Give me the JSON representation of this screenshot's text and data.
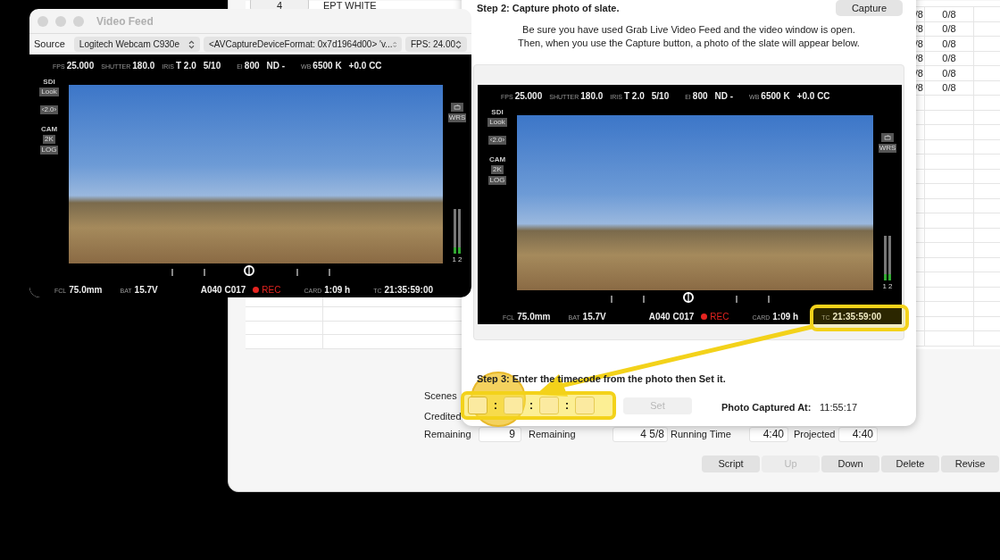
{
  "main_window": {
    "left_table": {
      "rows": [
        [
          "4",
          "EPT WHITE"
        ]
      ]
    },
    "right_table": {
      "rows": [
        [
          "/8",
          "0/8"
        ],
        [
          "/8",
          "0/8"
        ],
        [
          "/8",
          "0/8"
        ],
        [
          "/8",
          "0/8"
        ],
        [
          "/8",
          "0/8"
        ],
        [
          "/8",
          "0/8"
        ]
      ]
    },
    "summary": {
      "scenes_label": "Scenes",
      "credited_label": "Credited",
      "remaining_label": "Remaining",
      "remaining_value": "9",
      "remaining2_label": "Remaining",
      "remaining2_value": "4 5/8",
      "running_time_label": "Running Time",
      "running_time_value": "4:40",
      "projected_label": "Projected",
      "projected_value": "4:40"
    },
    "buttons": [
      {
        "label": "Script",
        "disabled": false
      },
      {
        "label": "Up",
        "disabled": true
      },
      {
        "label": "Down",
        "disabled": false
      },
      {
        "label": "Delete",
        "disabled": false
      },
      {
        "label": "Revise",
        "disabled": false
      }
    ]
  },
  "capture_dialog": {
    "step2_title": "Step 2: Capture photo of slate.",
    "capture_button": "Capture",
    "instructions": [
      "Be sure you have used Grab Live Video Feed and the video window is open.",
      "Then, when you use the Capture button, a photo of the slate will appear below."
    ],
    "viewfinder": {
      "top": [
        {
          "label": "FPS",
          "value": "25.000"
        },
        {
          "label": "SHUTTER",
          "value": "180.0"
        },
        {
          "label": "IRIS",
          "value": "T 2.0"
        },
        {
          "value": "5/10"
        },
        {
          "label": "EI",
          "value": "800"
        },
        {
          "value": "ND -"
        },
        {
          "label": "WB",
          "value": "6500 K"
        },
        {
          "value": "+0.0 CC"
        }
      ],
      "left": [
        {
          "kind": "heading",
          "text": "SDI"
        },
        {
          "kind": "chip",
          "text": "Look"
        },
        {
          "kind": "chip",
          "text": "‹2.0›"
        },
        {
          "kind": "heading",
          "text": "CAM"
        },
        {
          "kind": "chip",
          "text": "2K"
        },
        {
          "kind": "chip",
          "text": "LOG"
        }
      ],
      "right_chip": "WRS",
      "meter_labels": "1 2",
      "bottom": [
        {
          "label": "FCL",
          "value": "75.0mm"
        },
        {
          "label": "BAT",
          "value": "15.7V"
        },
        {
          "value": "A040 C017"
        },
        {
          "kind": "rec",
          "value": "REC"
        },
        {
          "label": "CARD",
          "value": "1:09 h"
        },
        {
          "label": "TC",
          "value": "21:35:59:00"
        }
      ]
    },
    "step3_title": "Step 3: Enter the timecode from the photo then Set it.",
    "timecode_separators": [
      ":",
      ":",
      ":"
    ],
    "set_button": {
      "label": "Set",
      "disabled": true
    },
    "captured_label": "Photo Captured At:",
    "captured_value": "11:55:17"
  },
  "video_feed": {
    "title": "Video Feed",
    "source_label": "Source",
    "selects": [
      "Logitech Webcam C930e",
      "<AVCaptureDeviceFormat: 0x7d1964d00> 'v...",
      "FPS: 24.00"
    ],
    "viewfinder": {
      "top": [
        {
          "label": "FPS",
          "value": "25.000"
        },
        {
          "label": "SHUTTER",
          "value": "180.0"
        },
        {
          "label": "IRIS",
          "value": "T 2.0"
        },
        {
          "value": "5/10"
        },
        {
          "label": "EI",
          "value": "800"
        },
        {
          "value": "ND -"
        },
        {
          "label": "WB",
          "value": "6500 K"
        },
        {
          "value": "+0.0 CC"
        }
      ],
      "left": [
        {
          "kind": "heading",
          "text": "SDI"
        },
        {
          "kind": "chip",
          "text": "Look"
        },
        {
          "kind": "chip",
          "text": "‹2.0›"
        },
        {
          "kind": "heading",
          "text": "CAM"
        },
        {
          "kind": "chip",
          "text": "2K"
        },
        {
          "kind": "chip",
          "text": "LOG"
        }
      ],
      "right_chip": "WRS",
      "meter_labels": "1 2",
      "bottom": [
        {
          "label": "FCL",
          "value": "75.0mm"
        },
        {
          "label": "BAT",
          "value": "15.7V"
        },
        {
          "value": "A040 C017"
        },
        {
          "kind": "rec",
          "value": "REC"
        },
        {
          "label": "CARD",
          "value": "1:09 h"
        },
        {
          "label": "TC",
          "value": "21:35:59:00"
        }
      ]
    }
  }
}
